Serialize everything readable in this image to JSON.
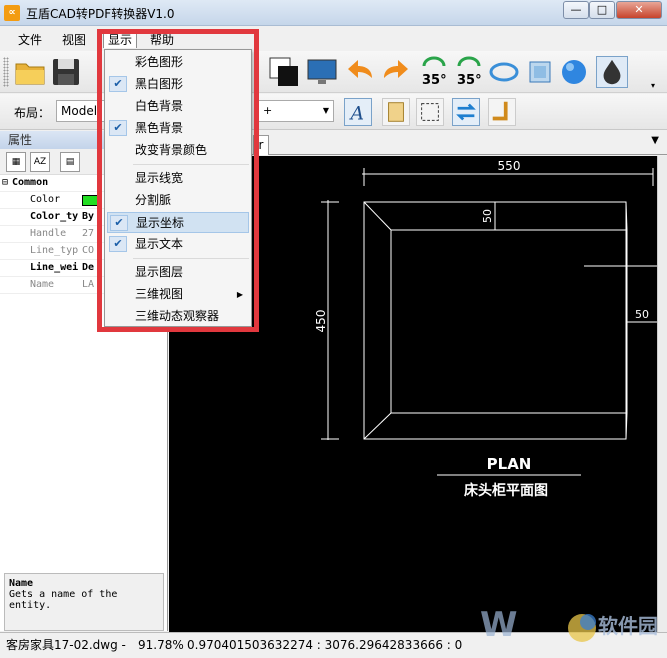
{
  "window": {
    "title": "互盾CAD转PDF转换器V1.0",
    "app_icon": "cad-app-icon"
  },
  "menubar": {
    "items": [
      "文件",
      "视图",
      "显示",
      "帮助"
    ],
    "active": "显示"
  },
  "toolbar2": {
    "layout_label": "布局：",
    "layout_value": "Model",
    "combo2_value": "+"
  },
  "left_panel": {
    "title": "属性",
    "category": "Common",
    "rows": [
      {
        "name": "Color",
        "value": "",
        "swatch": "#22dd22"
      },
      {
        "name": "Color_ty",
        "value": "By"
      },
      {
        "name": "Handle",
        "value": "27"
      },
      {
        "name": "Line_typ",
        "value": "CO"
      },
      {
        "name": "Line_wei",
        "value": "De"
      },
      {
        "name": "Name",
        "value": "LA"
      }
    ],
    "desc_title": "Name",
    "desc_text": "Gets a name of the entity."
  },
  "display_menu": {
    "items": [
      {
        "label": "彩色图形",
        "checked": false
      },
      {
        "label": "黑白图形",
        "checked": true
      },
      {
        "label": "白色背景",
        "checked": false
      },
      {
        "label": "黑色背景",
        "checked": true
      },
      {
        "label": "改变背景颜色",
        "checked": false
      },
      {
        "label": "显示线宽",
        "checked": false
      },
      {
        "label": "分割脈",
        "checked": false
      },
      {
        "label": "显示坐标",
        "checked": true,
        "highlighted": true
      },
      {
        "label": "显示文本",
        "checked": true
      },
      {
        "label": "显示图层",
        "checked": false
      },
      {
        "label": "三维视图",
        "checked": false,
        "submenu": true
      },
      {
        "label": "三维动态观察器",
        "checked": false
      }
    ]
  },
  "document_tab": "r",
  "drawing": {
    "dim_top": "550",
    "dim_left": "450",
    "dim_inner_top": "50",
    "dim_inner_right": "50",
    "plan_label": "PLAN",
    "plan_subtitle": "床头柜平面图"
  },
  "statusbar": {
    "file": "客房家具17-02.dwg -",
    "zoom": "91.78%",
    "coords": "0.970401503632274 : 3076.29642833666 : 0"
  },
  "watermark": {
    "text": "软件园"
  },
  "colors": {
    "accent_red": "#e1383e",
    "canvas_bg": "#000000",
    "highlight": "#d1e2f2"
  }
}
